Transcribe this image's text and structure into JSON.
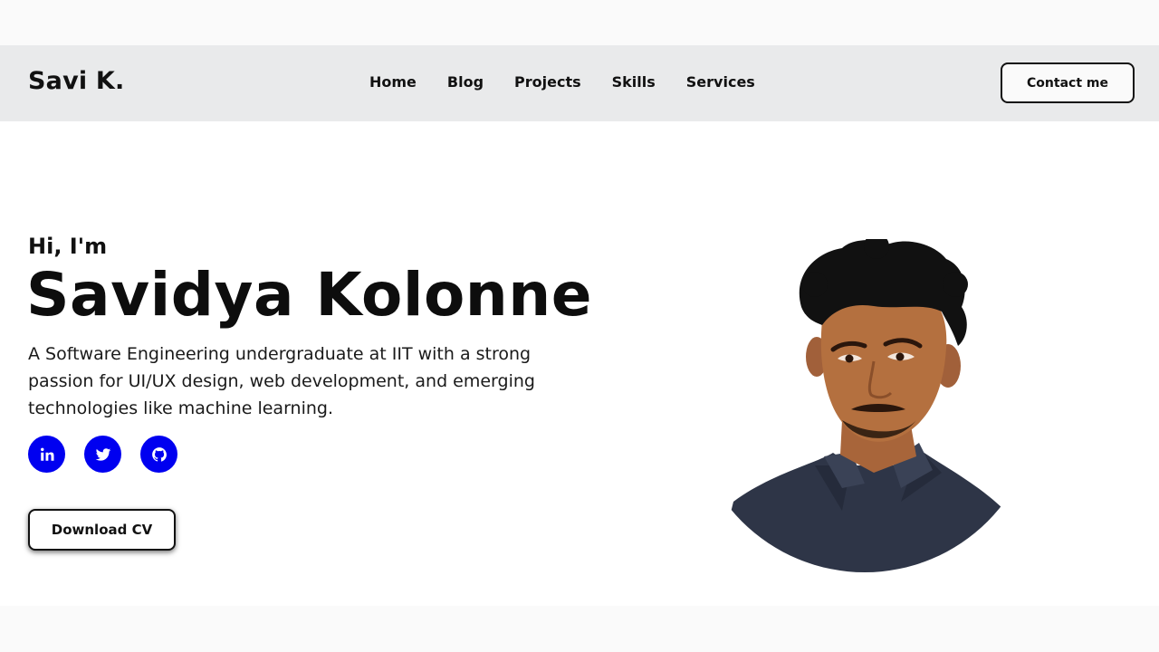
{
  "nav": {
    "brand": "Savi K.",
    "links": [
      "Home",
      "Blog",
      "Projects",
      "Skills",
      "Services"
    ],
    "contact_label": "Contact me"
  },
  "hero": {
    "greeting": "Hi, I'm",
    "name": "Savidya Kolonne",
    "bio": "A Software Engineering undergraduate at IIT with a strong passion for UI/UX design, web development, and emerging technologies like machine learning.",
    "socials": [
      {
        "icon": "linkedin-icon"
      },
      {
        "icon": "twitter-icon"
      },
      {
        "icon": "github-icon"
      }
    ],
    "cv_label": "Download CV"
  },
  "colors": {
    "accent": "#0000f0",
    "navbar_bg": "#e9eaeb",
    "text": "#111111"
  }
}
